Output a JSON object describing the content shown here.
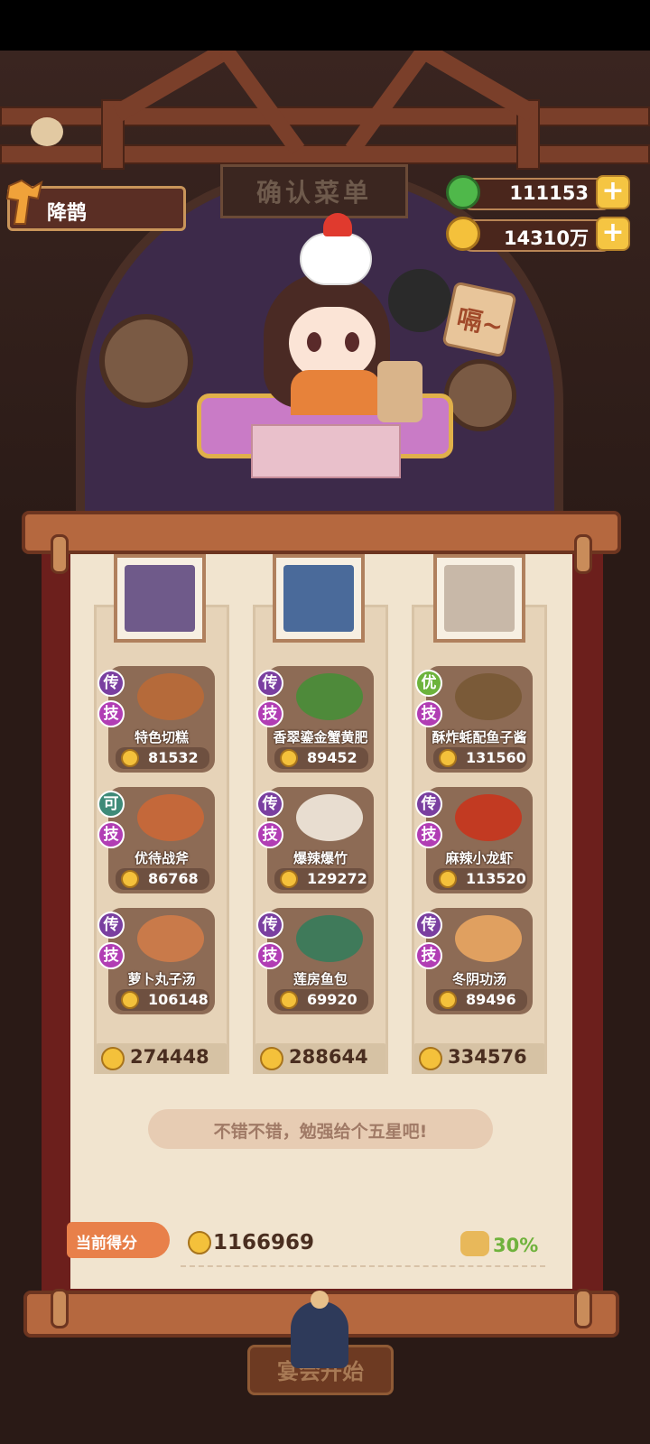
{
  "player": {
    "name": "降鹊"
  },
  "currency": {
    "jade": "111153",
    "coins": "14310万",
    "plus": "+"
  },
  "sign": "确认菜单",
  "character_speech": "嗝~",
  "columns": [
    {
      "dishes": [
        {
          "tier": "传",
          "tier_type": "legend",
          "skill": "技",
          "name": "特色切糕",
          "price": "81532"
        },
        {
          "tier": "可",
          "tier_type": "ok",
          "skill": "技",
          "name": "优待战斧",
          "price": "86768"
        },
        {
          "tier": "传",
          "tier_type": "legend",
          "skill": "技",
          "name": "萝卜丸子汤",
          "price": "106148"
        }
      ],
      "total": "274448"
    },
    {
      "dishes": [
        {
          "tier": "传",
          "tier_type": "legend",
          "skill": "技",
          "name": "香翠鎏金蟹黄肥",
          "price": "89452"
        },
        {
          "tier": "传",
          "tier_type": "legend",
          "skill": "技",
          "name": "爆辣爆竹",
          "price": "129272"
        },
        {
          "tier": "传",
          "tier_type": "legend",
          "skill": "技",
          "name": "莲房鱼包",
          "price": "69920"
        }
      ],
      "total": "288644"
    },
    {
      "dishes": [
        {
          "tier": "优",
          "tier_type": "good",
          "skill": "技",
          "name": "酥炸蚝配鱼子酱",
          "price": "131560"
        },
        {
          "tier": "传",
          "tier_type": "legend",
          "skill": "技",
          "name": "麻辣小龙虾",
          "price": "113520"
        },
        {
          "tier": "传",
          "tier_type": "legend",
          "skill": "技",
          "name": "冬阴功汤",
          "price": "89496"
        }
      ],
      "total": "334576"
    }
  ],
  "comment": "不错不错，勉强给个五星吧!",
  "score": {
    "label": "当前得分",
    "value": "1166969",
    "bonus": "30%"
  },
  "start_button": "宴会开始",
  "colors": {
    "board": "#f1e4cf",
    "frame": "#6c1f1c",
    "coin": "#f4c13b",
    "legend_badge": "#7a3fa0",
    "skill_badge": "#b13db4",
    "good_badge": "#6db33c",
    "bonus_green": "#6fb23c"
  }
}
